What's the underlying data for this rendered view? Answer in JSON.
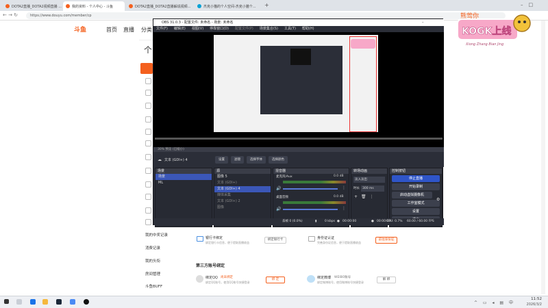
{
  "browser": {
    "tabs": [
      {
        "title": "DOTA2直播_DOTA2视频直播 ..."
      },
      {
        "title": "我的资料 - 个人中心 - 斗鱼"
      },
      {
        "title": "DOTA2直播_DOTA2直播解说视频..."
      },
      {
        "title": "杰克小猫的个人空间-杰克小猫个..."
      }
    ],
    "url": "https://www.douyu.com/member/cp"
  },
  "site": {
    "logo": "斗鱼",
    "nav": [
      "首页",
      "直播",
      "分类"
    ],
    "page_heading": "个",
    "sidebar": [
      "我的中奖记录",
      "消费记录",
      "我的头衔",
      "房间管理",
      "斗鱼BUFF"
    ],
    "bank_title": "银行卡绑定",
    "bank_desc": "绑定银行卡信息，便于提取直播收益",
    "bank_btn": "绑定银行卡",
    "id_title": "身份证认证",
    "id_desc": "完善身份证信息，便于提取直播收益",
    "id_btn": "前往身份证",
    "third_heading": "第三方账号绑定",
    "qq_title": "绑定QQ",
    "qq_status": "尚未绑定",
    "qq_desc": "绑定QQ账号，使用QQ账号快捷登录",
    "qq_btn": "绑 定",
    "wb_title": "绑定微博",
    "wb_status": "WEIBO账号",
    "wb_desc": "绑定微博账号，使用微博账号快捷登录",
    "wb_btn": "解 绑"
  },
  "obs": {
    "title": "OBS 31.0.3 - 配置文件: 未命名 - 场景: 未命名",
    "menu": [
      "文件(F)",
      "编辑(E)",
      "视图(V)",
      "停靠窗口(D)",
      "配置文件(P)",
      "场景集合(S)",
      "工具(T)",
      "帮助(H)"
    ],
    "preview_caption": "30%  预览 (已缩小)",
    "source_label": "文本 (GDI+) 4",
    "toolbar": [
      "设置",
      "滤镜",
      "选择字体",
      "选择颜色"
    ],
    "docks": {
      "scenes": {
        "title": "场景",
        "items": [
          "场景",
          "ML"
        ]
      },
      "sources": {
        "title": "源",
        "items": [
          "图像 5",
          "文本 (GDI+)",
          "文本 (GDI+) 4",
          "媒体采集",
          "文本 (GDI+) 2",
          "图像"
        ]
      },
      "mixer": {
        "title": "混音器",
        "channels": [
          {
            "name": "麦克风/Aux",
            "db": "0.0 dB"
          },
          {
            "name": "桌面音频",
            "db": "0.0 dB"
          }
        ]
      },
      "transitions": {
        "title": "转场动画",
        "value": "淡入淡出",
        "duration_label": "时长",
        "duration": "300 ms"
      },
      "controls": {
        "title": "控制按钮",
        "buttons": [
          "停止直播",
          "开始录制",
          "启动虚拟摄像机",
          "工作室模式",
          "设置",
          "退出"
        ]
      }
    },
    "status": {
      "dropped": "丢帧 0 (0.0%)",
      "kbps": "0 kbps",
      "live": "00:00:00",
      "rec": "00:00:00",
      "cpu": "CPU: 0.7%",
      "fps": "60.00 / 60.00 FPS"
    }
  },
  "taskbar": {
    "time": "11:52",
    "date": "2026/3/2"
  },
  "watermark": {
    "top": "熊莺你",
    "main": "KOGK上线",
    "sub": "Xiong Zhang Bian Jing"
  }
}
